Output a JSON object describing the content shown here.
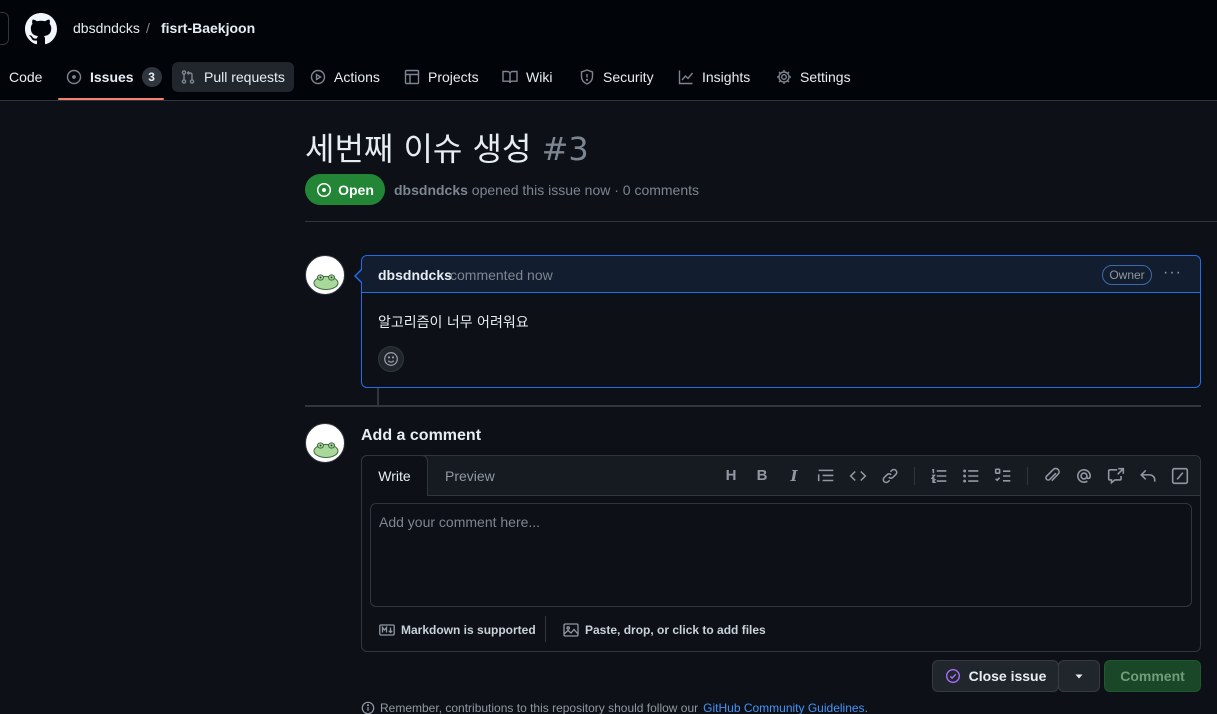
{
  "header": {
    "owner": "dbsdndcks",
    "separator": "/",
    "repo": "fisrt-Baekjoon"
  },
  "tabs": [
    {
      "label": "Code",
      "icon": "code-icon"
    },
    {
      "label": "Issues",
      "icon": "issue-opened-icon",
      "count": "3",
      "active": true
    },
    {
      "label": "Pull requests",
      "icon": "git-pull-request-icon"
    },
    {
      "label": "Actions",
      "icon": "play-icon"
    },
    {
      "label": "Projects",
      "icon": "table-icon"
    },
    {
      "label": "Wiki",
      "icon": "book-icon"
    },
    {
      "label": "Security",
      "icon": "shield-icon"
    },
    {
      "label": "Insights",
      "icon": "graph-icon"
    },
    {
      "label": "Settings",
      "icon": "gear-icon"
    }
  ],
  "issue": {
    "title": "세번째 이슈 생성",
    "number": "#3",
    "state": "Open",
    "author": "dbsdndcks",
    "meta": "opened this issue now · 0 comments"
  },
  "comment": {
    "author": "dbsdndcks",
    "when": "commented now",
    "role": "Owner",
    "menu": "···",
    "body": "알고리즘이 너무 어려워요"
  },
  "composer": {
    "title": "Add a comment",
    "tab_write": "Write",
    "tab_preview": "Preview",
    "heading_tool": "H",
    "bold_tool": "B",
    "italic_tool": "I",
    "placeholder": "Add your comment here...",
    "markdown_note": "Markdown is supported",
    "attach_note": "Paste, drop, or click to add files"
  },
  "actions": {
    "close_label": "Close issue",
    "comment_label": "Comment"
  },
  "footnote": {
    "text": "Remember, contributions to this repository should follow our",
    "link": "GitHub Community Guidelines",
    "end": "."
  },
  "colors": {
    "accent": "#1f6feb",
    "open_green": "#238636",
    "tab_underline": "#f78166",
    "close_purple": "#a371f7"
  }
}
